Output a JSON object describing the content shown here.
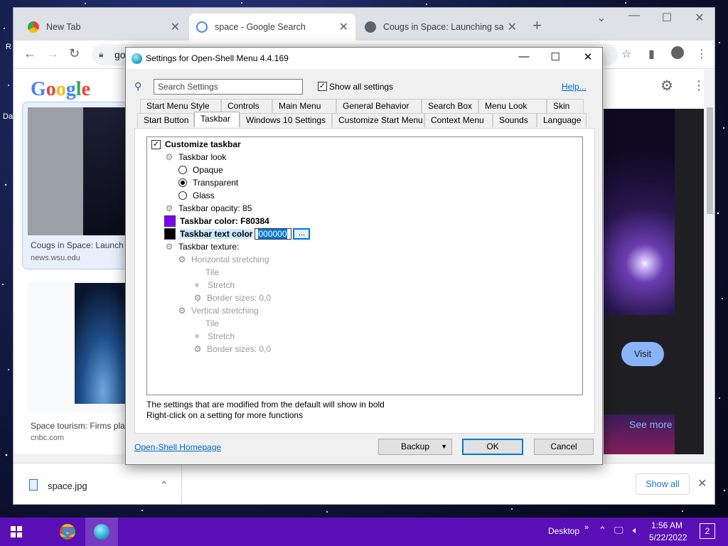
{
  "desktop": {
    "label_fragments": [
      "R",
      "Da"
    ]
  },
  "browser": {
    "tabs": [
      {
        "title": "New Tab",
        "active": false
      },
      {
        "title": "space - Google Search",
        "active": true
      },
      {
        "title": "Cougs in Space: Launching satell",
        "active": false
      }
    ],
    "new_tab_symbol": "+",
    "omnibox_text": "go",
    "window_controls": [
      "—",
      "☐",
      "✕"
    ],
    "results": [
      {
        "caption": "Cougs in Space: Launch",
        "source": "news.wsu.edu"
      },
      {
        "caption": "Space tourism: Firms pla",
        "source": "cnbc.com"
      }
    ],
    "visit_label": "Visit",
    "see_more_label": "See more",
    "download": {
      "file": "space.jpg",
      "show_all_label": "Show all"
    }
  },
  "dialog": {
    "title": "Settings for Open-Shell Menu 4.4.169",
    "search_placeholder": "Search Settings",
    "show_all_label": "Show all settings",
    "help_label": "Help...",
    "tabs_row1": [
      "Start Menu Style",
      "Controls",
      "Main Menu",
      "General Behavior",
      "Search Box",
      "Menu Look",
      "Skin"
    ],
    "tabs_row2": [
      "Start Button",
      "Taskbar",
      "Windows 10 Settings",
      "Customize Start Menu",
      "Context Menu",
      "Sounds",
      "Language"
    ],
    "selected_tab": "Taskbar",
    "tree": {
      "customize": "Customize taskbar",
      "look": "Taskbar look",
      "opaque": "Opaque",
      "transparent": "Transparent",
      "glass": "Glass",
      "opacity": "Taskbar opacity: 85",
      "color": "Taskbar color: F80384",
      "text_color": "Taskbar text color",
      "text_color_value": "000000",
      "browse": "...",
      "texture": "Taskbar texture:",
      "h_stretch": "Horizontal stretching",
      "tile1": "Tile",
      "stretch1": "Stretch",
      "border1": "Border sizes: 0,0",
      "v_stretch": "Vertical stretching",
      "tile2": "Tile",
      "stretch2": "Stretch",
      "border2": "Border sizes: 0,0"
    },
    "colors": {
      "taskbar_color": "#8000ff",
      "text_color": "#000000"
    },
    "note1": "The settings that are modified from the default will show in bold",
    "note2": "Right-click on a setting for more functions",
    "homepage_label": "Open-Shell Homepage",
    "backup_label": "Backup",
    "ok_label": "OK",
    "cancel_label": "Cancel"
  },
  "taskbar": {
    "desktop_label": "Desktop",
    "time": "1:56 AM",
    "date": "5/22/2022",
    "notification_count": "2"
  }
}
